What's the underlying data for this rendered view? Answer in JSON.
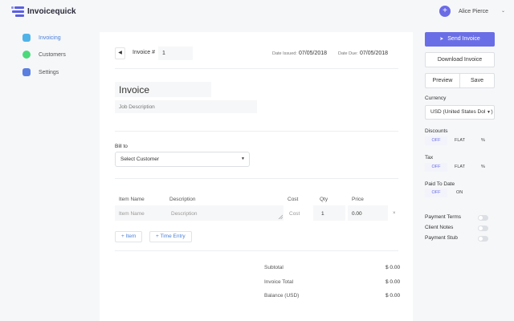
{
  "app": {
    "name": "Invoicequick"
  },
  "user": {
    "initial": "+",
    "name": "Alice Pierce",
    "chevron": "⌄"
  },
  "sidebar": {
    "items": [
      {
        "label": "Invoicing",
        "icon": "invoice-icon",
        "color": "#4fb3e8",
        "active": true
      },
      {
        "label": "Customers",
        "icon": "customers-icon",
        "color": "#4cd97b",
        "active": false
      },
      {
        "label": "Settings",
        "icon": "settings-icon",
        "color": "#5a7fe0",
        "active": false
      }
    ]
  },
  "invoice": {
    "back_icon": "◀",
    "number_label": "Invoice #",
    "number_value": "1",
    "date_issued_label": "Date Issued:",
    "date_issued": "07/05/2018",
    "date_due_label": "Date Due:",
    "date_due": "07/05/2018",
    "title": "Invoice",
    "description_placeholder": "Job Description",
    "bill_to_label": "Bill to",
    "customer_select": "Select Customer",
    "caret": "▼"
  },
  "items_table": {
    "headers": [
      "Item Name",
      "Description",
      "Cost",
      "Qty",
      "Price"
    ],
    "row": {
      "item_name": "Item Name",
      "description": "Description",
      "cost": "Cost",
      "qty": "1",
      "price": "0.00",
      "remove": "×"
    }
  },
  "buttons": {
    "add_item": "+ Item",
    "add_time": "+ Time Entry"
  },
  "totals": [
    {
      "label": "Subtotal",
      "value": "$ 0.00"
    },
    {
      "label": "Invoice Total",
      "value": "$ 0.00"
    },
    {
      "label": "Balance (USD)",
      "value": "$ 0.00"
    }
  ],
  "panel": {
    "send_label": "Send Invoice",
    "send_icon": "➤",
    "download_label": "Download Invoice",
    "preview_label": "Preview",
    "save_label": "Save",
    "currency_label": "Currency",
    "currency_value": "USD (United States Dollar)",
    "discounts_label": "Discounts",
    "tax_label": "Tax",
    "paid_label": "Paid To Date",
    "off": "OFF",
    "flat": "FLAT",
    "percent": "%",
    "on": "ON",
    "payment_terms": "Payment Terms",
    "client_notes": "Client Notes",
    "payment_stub": "Payment Stub"
  },
  "colors": {
    "accent": "#6a6ee6",
    "link": "#4a7fd9"
  }
}
